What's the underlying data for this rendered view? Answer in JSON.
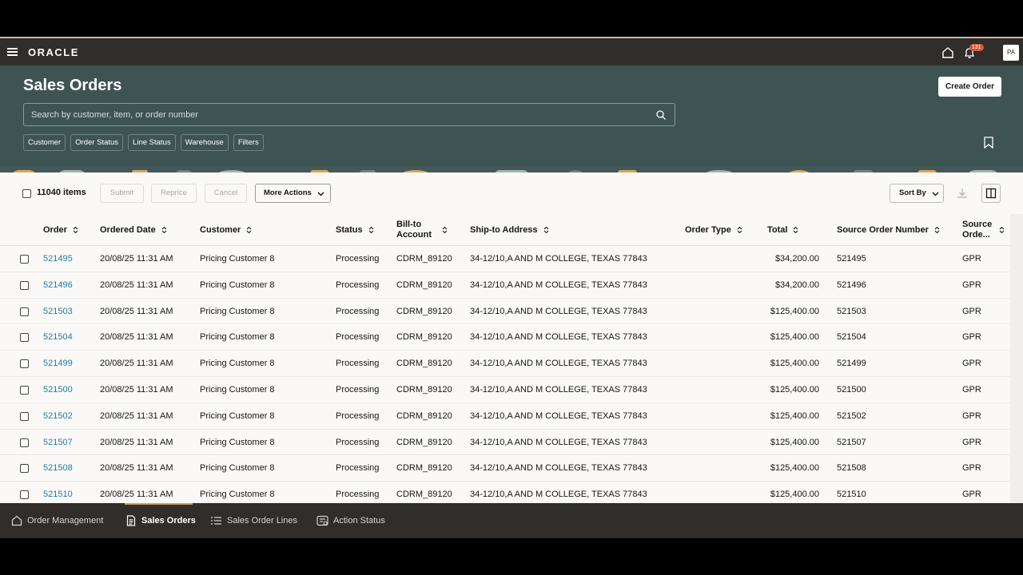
{
  "app": {
    "logo": "ORACLE",
    "notifications": "131",
    "avatar": "PA"
  },
  "page": {
    "title": "Sales Orders",
    "create_label": "Create Order",
    "search_placeholder": "Search by customer, item, or order number",
    "chips": [
      "Customer",
      "Order Status",
      "Line Status",
      "Warehouse",
      "Filters"
    ]
  },
  "toolbar": {
    "count": "11040 items",
    "submit": "Submit",
    "reprice": "Reprice",
    "cancel": "Cancel",
    "more_actions": "More Actions",
    "sort_by": "Sort By"
  },
  "columns": [
    "Order",
    "Ordered Date",
    "Customer",
    "Status",
    "Bill-to Account",
    "Ship-to Address",
    "Order Type",
    "Total",
    "Source Order Number",
    "Source Orde..."
  ],
  "rows": [
    {
      "order": "521495",
      "date": "20/08/25 11:31 AM",
      "customer": "Pricing Customer 8",
      "status": "Processing",
      "bill_to": "CDRM_89120",
      "ship_to": "34-12/10,A AND M COLLEGE, TEXAS 77843",
      "type": "",
      "total": "$34,200.00",
      "source_no": "521495",
      "source": "GPR"
    },
    {
      "order": "521496",
      "date": "20/08/25 11:31 AM",
      "customer": "Pricing Customer 8",
      "status": "Processing",
      "bill_to": "CDRM_89120",
      "ship_to": "34-12/10,A AND M COLLEGE, TEXAS 77843",
      "type": "",
      "total": "$34,200.00",
      "source_no": "521496",
      "source": "GPR"
    },
    {
      "order": "521503",
      "date": "20/08/25 11:31 AM",
      "customer": "Pricing Customer 8",
      "status": "Processing",
      "bill_to": "CDRM_89120",
      "ship_to": "34-12/10,A AND M COLLEGE, TEXAS 77843",
      "type": "",
      "total": "$125,400.00",
      "source_no": "521503",
      "source": "GPR"
    },
    {
      "order": "521504",
      "date": "20/08/25 11:31 AM",
      "customer": "Pricing Customer 8",
      "status": "Processing",
      "bill_to": "CDRM_89120",
      "ship_to": "34-12/10,A AND M COLLEGE, TEXAS 77843",
      "type": "",
      "total": "$125,400.00",
      "source_no": "521504",
      "source": "GPR"
    },
    {
      "order": "521499",
      "date": "20/08/25 11:31 AM",
      "customer": "Pricing Customer 8",
      "status": "Processing",
      "bill_to": "CDRM_89120",
      "ship_to": "34-12/10,A AND M COLLEGE, TEXAS 77843",
      "type": "",
      "total": "$125,400.00",
      "source_no": "521499",
      "source": "GPR"
    },
    {
      "order": "521500",
      "date": "20/08/25 11:31 AM",
      "customer": "Pricing Customer 8",
      "status": "Processing",
      "bill_to": "CDRM_89120",
      "ship_to": "34-12/10,A AND M COLLEGE, TEXAS 77843",
      "type": "",
      "total": "$125,400.00",
      "source_no": "521500",
      "source": "GPR"
    },
    {
      "order": "521502",
      "date": "20/08/25 11:31 AM",
      "customer": "Pricing Customer 8",
      "status": "Processing",
      "bill_to": "CDRM_89120",
      "ship_to": "34-12/10,A AND M COLLEGE, TEXAS 77843",
      "type": "",
      "total": "$125,400.00",
      "source_no": "521502",
      "source": "GPR"
    },
    {
      "order": "521507",
      "date": "20/08/25 11:31 AM",
      "customer": "Pricing Customer 8",
      "status": "Processing",
      "bill_to": "CDRM_89120",
      "ship_to": "34-12/10,A AND M COLLEGE, TEXAS 77843",
      "type": "",
      "total": "$125,400.00",
      "source_no": "521507",
      "source": "GPR"
    },
    {
      "order": "521508",
      "date": "20/08/25 11:31 AM",
      "customer": "Pricing Customer 8",
      "status": "Processing",
      "bill_to": "CDRM_89120",
      "ship_to": "34-12/10,A AND M COLLEGE, TEXAS 77843",
      "type": "",
      "total": "$125,400.00",
      "source_no": "521508",
      "source": "GPR"
    },
    {
      "order": "521510",
      "date": "20/08/25 11:31 AM",
      "customer": "Pricing Customer 8",
      "status": "Processing",
      "bill_to": "CDRM_89120",
      "ship_to": "34-12/10,A AND M COLLEGE, TEXAS 77843",
      "type": "",
      "total": "$125,400.00",
      "source_no": "521510",
      "source": "GPR"
    }
  ],
  "bottom_nav": [
    {
      "label": "Order Management",
      "icon": "home-icon"
    },
    {
      "label": "Sales Orders",
      "icon": "document-icon",
      "active": true
    },
    {
      "label": "Sales Order Lines",
      "icon": "list-icon"
    },
    {
      "label": "Action Status",
      "icon": "status-icon"
    }
  ],
  "colors": {
    "topbar": "#312d2a",
    "header": "#3e5453",
    "link": "#227e9e",
    "accent": "#c7a654"
  }
}
